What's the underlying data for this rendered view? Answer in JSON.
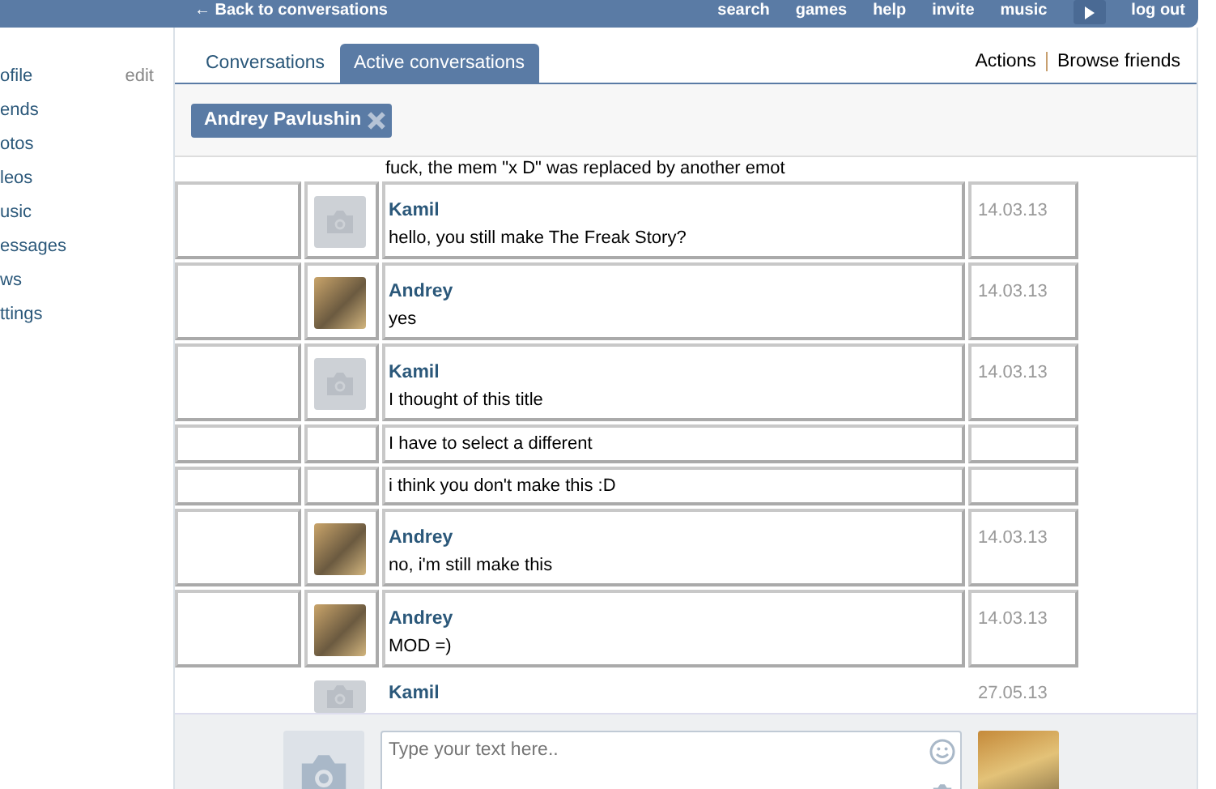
{
  "top_bar": {
    "back_link": "← Back to conversations",
    "links": [
      "search",
      "games",
      "help",
      "invite",
      "music"
    ],
    "logout": "log out"
  },
  "sidebar": {
    "items": [
      {
        "label": "ofile",
        "action": "edit"
      },
      {
        "label": "ends"
      },
      {
        "label": "otos"
      },
      {
        "label": "leos"
      },
      {
        "label": "usic"
      },
      {
        "label": "essages"
      },
      {
        "label": "ws"
      },
      {
        "label": "ttings"
      }
    ]
  },
  "tabs": [
    {
      "label": "Conversations",
      "selected": false
    },
    {
      "label": "Active conversations",
      "selected": true
    }
  ],
  "actions": [
    "Actions",
    "Browse friends"
  ],
  "filter_chip": {
    "label": "Andrey Pavlushin"
  },
  "cut_message": "fuck, the mem \"x D\" was replaced by another emot",
  "messages": [
    {
      "kind": "full",
      "avatar_photo": false,
      "author": "Kamil",
      "text": "hello, you still make The Freak Story?",
      "date": "14.03.13"
    },
    {
      "kind": "full",
      "avatar_photo": true,
      "author": "Andrey",
      "text": "yes",
      "date": "14.03.13"
    },
    {
      "kind": "full",
      "avatar_photo": false,
      "author": "Kamil",
      "text": "I thought of this title",
      "date": "14.03.13"
    },
    {
      "kind": "continuation",
      "text": "I have to select a different"
    },
    {
      "kind": "continuation",
      "text": "i think you don't make this :D"
    },
    {
      "kind": "full",
      "avatar_photo": true,
      "author": "Andrey",
      "text": "no, i'm still make this",
      "date": "14.03.13"
    },
    {
      "kind": "full",
      "avatar_photo": true,
      "author": "Andrey",
      "text": "MOD =)",
      "date": "14.03.13"
    },
    {
      "kind": "plain",
      "avatar_photo": false,
      "author": "Kamil",
      "date": "27.05.13"
    }
  ],
  "composer": {
    "placeholder": "Type your text here.."
  }
}
